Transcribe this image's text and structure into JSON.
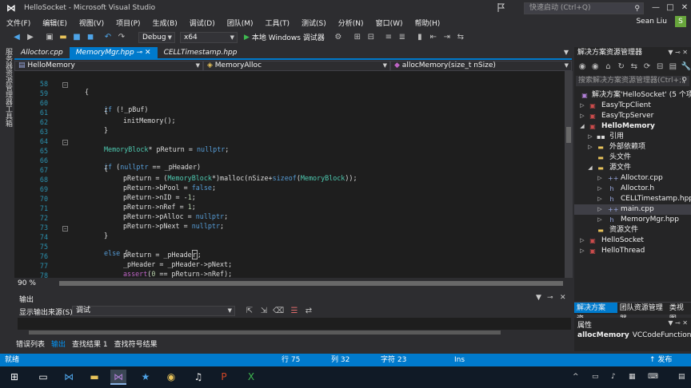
{
  "title_bar": {
    "app_title": "HelloSocket - Microsoft Visual Studio",
    "quick_launch_placeholder": "快速启动 (Ctrl+Q)",
    "minimize": "—",
    "maximize": "□",
    "close": "✕"
  },
  "menu": {
    "items": [
      "文件(F)",
      "编辑(E)",
      "视图(V)",
      "项目(P)",
      "生成(B)",
      "调试(D)",
      "团队(M)",
      "工具(T)",
      "测试(S)",
      "分析(N)",
      "窗口(W)",
      "帮助(H)"
    ],
    "user_name": "Sean Liu",
    "avatar_letter": "S"
  },
  "toolbar": {
    "config": "Debug",
    "platform": "x64",
    "start_label": "本地 Windows 调试器"
  },
  "left_strip": {
    "tab1": "服务器资源管理器",
    "tab2": "工具箱"
  },
  "doc_tabs": {
    "tabs": [
      "Alloctor.cpp",
      "MemoryMgr.hpp",
      "CELLTimestamp.hpp"
    ],
    "active_index": 1
  },
  "nav_bar": {
    "project": "HelloMemory",
    "scope": "MemoryAlloc",
    "member": "allocMemory(size_t nSize)"
  },
  "editor": {
    "lines": [
      {
        "n": "58",
        "text": "{"
      },
      {
        "n": "59",
        "text": "if (!_pBuf)"
      },
      {
        "n": "60",
        "text": "{"
      },
      {
        "n": "61",
        "text": "initMemory();"
      },
      {
        "n": "62",
        "text": "}"
      },
      {
        "n": "63",
        "text": ""
      },
      {
        "n": "64",
        "text": "MemoryBlock* pReturn = nullptr;"
      },
      {
        "n": "65",
        "text": "if (nullptr == _pHeader)"
      },
      {
        "n": "66",
        "text": "{"
      },
      {
        "n": "67",
        "text": "pReturn = (MemoryBlock*)malloc(nSize+sizeof(MemoryBlock));"
      },
      {
        "n": "68",
        "text": "pReturn->bPool = false;"
      },
      {
        "n": "69",
        "text": "pReturn->nID = -1;"
      },
      {
        "n": "70",
        "text": "pReturn->nRef = 1;"
      },
      {
        "n": "71",
        "text": "pReturn->pAlloc = nullptr;"
      },
      {
        "n": "72",
        "text": "pReturn->pNext = nullptr;"
      },
      {
        "n": "73",
        "text": "}"
      },
      {
        "n": "74",
        "text": "else {"
      },
      {
        "n": "75",
        "text": "pReturn = _pHeader;"
      },
      {
        "n": "76",
        "text": "_pHeader = _pHeader->pNext;"
      },
      {
        "n": "77",
        "text": "assert(0 == pReturn->nRef);"
      },
      {
        "n": "78",
        "text": "pReturn->nRef = 1;"
      }
    ],
    "zoom": "90 %"
  },
  "output": {
    "title": "输出",
    "source_label": "显示输出来源(S):",
    "source_value": "调试",
    "bottom_tabs": [
      "错误列表",
      "输出",
      "查找结果 1",
      "查找符号结果"
    ],
    "active_tab_index": 1
  },
  "solution_explorer": {
    "title": "解决方案资源管理器",
    "search_placeholder": "搜索解决方案资源管理器(Ctrl+;)",
    "items": [
      {
        "label": "解决方案'HelloSocket' (5 个项目)",
        "icon": "solution-icon"
      },
      {
        "label": "EasyTcpClient",
        "icon": "project-icon"
      },
      {
        "label": "EasyTcpServer",
        "icon": "project-icon"
      },
      {
        "label": "HelloMemory",
        "icon": "project-icon"
      },
      {
        "label": "引用",
        "icon": "references-icon"
      },
      {
        "label": "外部依赖项",
        "icon": "external-deps-icon"
      },
      {
        "label": "头文件",
        "icon": "folder-icon"
      },
      {
        "label": "源文件",
        "icon": "folder-icon"
      },
      {
        "label": "Alloctor.cpp",
        "icon": "cpp-file-icon"
      },
      {
        "label": "Alloctor.h",
        "icon": "header-file-icon"
      },
      {
        "label": "CELLTimestamp.hpp",
        "icon": "header-file-icon"
      },
      {
        "label": "main.cpp",
        "icon": "cpp-file-icon"
      },
      {
        "label": "MemoryMgr.hpp",
        "icon": "header-file-icon"
      },
      {
        "label": "资源文件",
        "icon": "folder-icon"
      },
      {
        "label": "HelloSocket",
        "icon": "project-icon"
      },
      {
        "label": "HelloThread",
        "icon": "project-icon"
      }
    ],
    "tabs": [
      "解决方案资...",
      "团队资源管理器",
      "类视图"
    ]
  },
  "properties": {
    "title": "属性",
    "selected_name": "allocMemory",
    "selected_type": "VCCodeFunction"
  },
  "status_bar": {
    "state": "就绪",
    "line": "行 75",
    "col": "列 32",
    "char": "字符 23",
    "mode": "Ins",
    "publish": "↑ 发布"
  },
  "colors": {
    "accent": "#007acc",
    "keyword": "#569cd6",
    "type": "#4ec9b0",
    "macro": "#bd63c5"
  }
}
